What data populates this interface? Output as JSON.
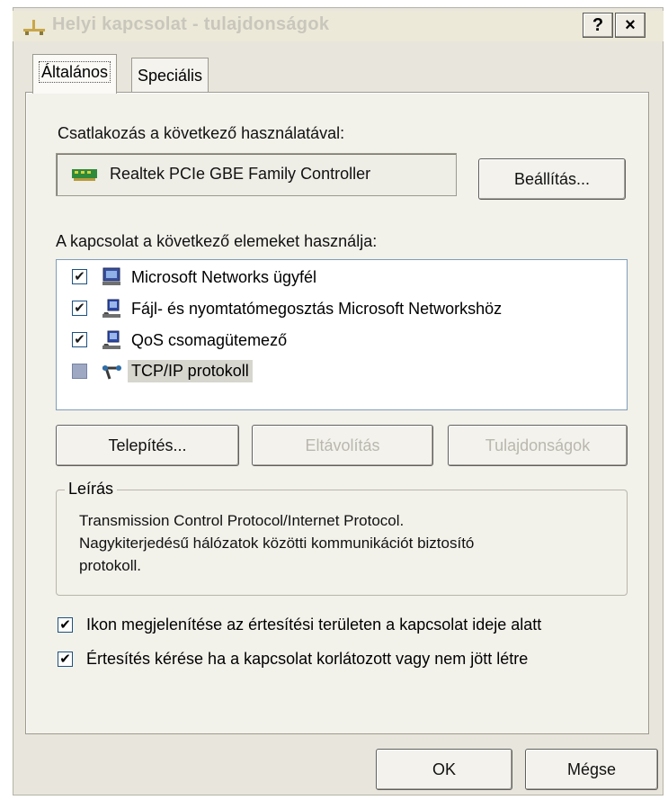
{
  "window": {
    "title": "Helyi kapcsolat - tulajdonságok",
    "help_button": "?",
    "close_button": "×"
  },
  "tabs": [
    {
      "label": "Általános",
      "active": true
    },
    {
      "label": "Speciális",
      "active": false
    }
  ],
  "connect_using": {
    "label": "Csatlakozás a következő használatával:",
    "adapter_name": "Realtek PCIe GBE Family Controller",
    "configure_button": "Beállítás..."
  },
  "components": {
    "label": "A kapcsolat a következő elemeket használja:",
    "items": [
      {
        "label": "Microsoft Networks ügyfél",
        "checked": true,
        "icon": "network-client-icon"
      },
      {
        "label": "Fájl- és nyomtatómegosztás Microsoft Networkshöz",
        "checked": true,
        "icon": "file-printer-sharing-icon"
      },
      {
        "label": "QoS csomagütemező",
        "checked": true,
        "icon": "qos-scheduler-icon"
      },
      {
        "label": "TCP/IP protokoll",
        "checked": false,
        "selected": true,
        "icon": "protocol-icon"
      }
    ],
    "install_button": "Telepítés...",
    "uninstall_button": "Eltávolítás",
    "properties_button": "Tulajdonságok"
  },
  "description": {
    "legend": "Leírás",
    "line1": "Transmission Control Protocol/Internet Protocol.",
    "line2": "Nagykiterjedésű hálózatok közötti kommunikációt biztosító",
    "line3": "protokoll."
  },
  "options": [
    {
      "label": "Ikon megjelenítése az értesítési területen a kapcsolat ideje alatt",
      "checked": true
    },
    {
      "label": "Értesítés kérése ha a kapcsolat korlátozott vagy nem jött létre",
      "checked": true
    }
  ],
  "footer": {
    "ok_button": "OK",
    "cancel_button": "Mégse"
  },
  "check_mark": "✔"
}
